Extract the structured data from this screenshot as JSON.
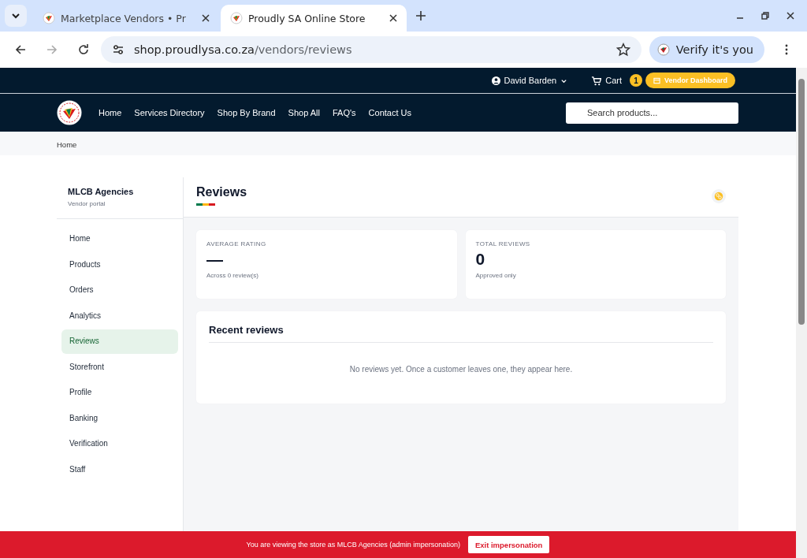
{
  "browser": {
    "tabs": [
      {
        "title": "Marketplace Vendors • Pr",
        "selected": false
      },
      {
        "title": "Proudly SA Online Store",
        "selected": true
      }
    ],
    "url_host": "shop.proudlysa.co.za",
    "url_path": "/vendors/reviews",
    "profile_button": "Verify it's you"
  },
  "topbar": {
    "user": "David Barden",
    "cart": "Cart",
    "cart_count": "1",
    "dashboard": "Vendor Dashboard"
  },
  "nav": {
    "links": [
      "Home",
      "Services Directory",
      "Shop By Brand",
      "Shop All",
      "FAQ's",
      "Contact Us"
    ],
    "search": {
      "placeholder": "Search products..."
    }
  },
  "breadcrumb": "Home",
  "sidebar": {
    "vendor": "MLCB Agencies",
    "subtitle": "Vendor portal",
    "items": [
      {
        "label": "Home",
        "selected": false
      },
      {
        "label": "Products",
        "selected": false
      },
      {
        "label": "Orders",
        "selected": false
      },
      {
        "label": "Analytics",
        "selected": false
      },
      {
        "label": "Reviews",
        "selected": true
      },
      {
        "label": "Storefront",
        "selected": false
      },
      {
        "label": "Profile",
        "selected": false
      },
      {
        "label": "Banking",
        "selected": false
      },
      {
        "label": "Verification",
        "selected": false
      },
      {
        "label": "Staff",
        "selected": false
      }
    ]
  },
  "page": {
    "title": "Reviews",
    "stats": [
      {
        "label": "AVERAGE RATING",
        "value": "—",
        "note": "Across 0 review(s)"
      },
      {
        "label": "TOTAL REVIEWS",
        "value": "0",
        "note": "Approved only"
      }
    ],
    "recent": {
      "title": "Recent reviews",
      "empty": "No reviews yet. Once a customer leaves one, they appear here."
    }
  },
  "banner": {
    "text": "You are viewing the store as MLCB Agencies (admin impersonation)",
    "button": "Exit impersonation"
  }
}
